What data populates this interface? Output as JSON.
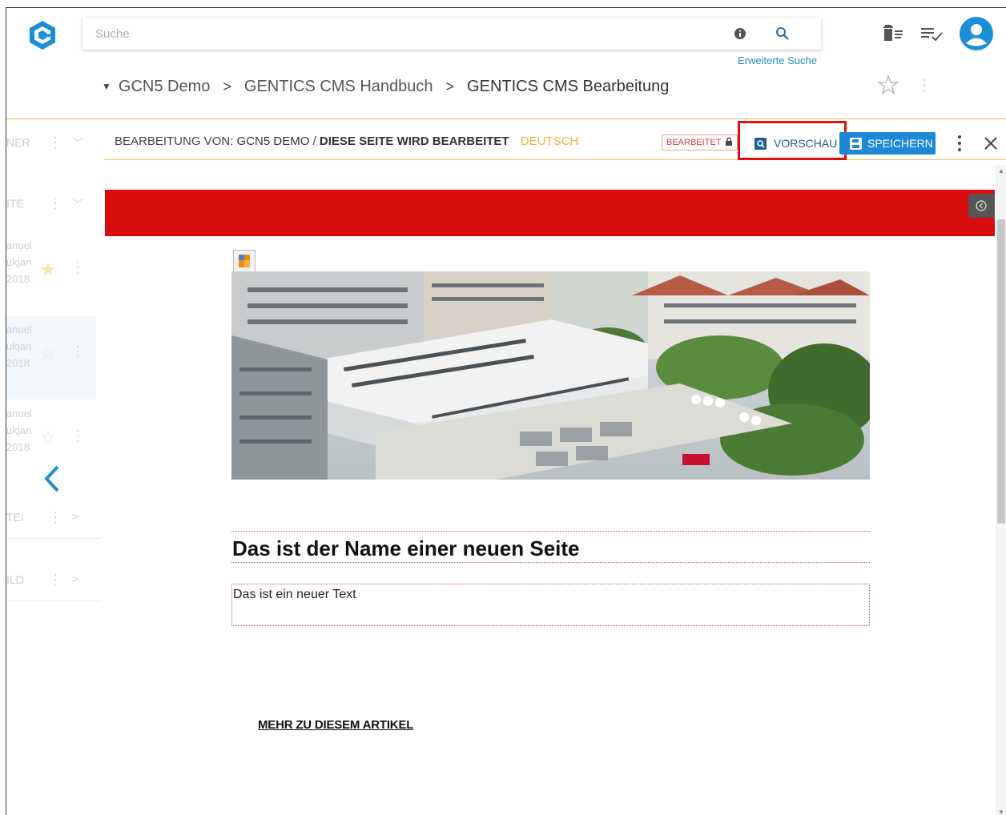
{
  "header": {
    "search_placeholder": "Suche",
    "advanced_search": "Erweiterte Suche"
  },
  "breadcrumb": {
    "items": [
      "GCN5 Demo",
      "GENTICS CMS Handbuch",
      "GENTICS CMS Bearbeitung"
    ]
  },
  "sidebar": {
    "sections": [
      {
        "label": "NER"
      },
      {
        "label": "ITE"
      },
      {
        "label": "TEI"
      },
      {
        "label": "ILD"
      }
    ],
    "items": [
      {
        "line1": "anuel",
        "line2": "ukjan",
        "line3": "2018",
        "favorite": true
      },
      {
        "line1": "anuel",
        "line2": "ukjan",
        "line3": "2018",
        "favorite": false
      },
      {
        "line1": "anuel",
        "line2": "ukjan",
        "line3": "2018",
        "favorite": false
      }
    ]
  },
  "editbar": {
    "label_prefix": "BEARBEITUNG VON:",
    "node": "GCN5 DEMO",
    "separator": "/",
    "page_title": "DIESE SEITE WIRD BEARBEITET",
    "language": "DEUTSCH",
    "status": "BEARBEITET",
    "preview_label": "VORSCHAU",
    "save_label": "SPEICHERN"
  },
  "page": {
    "heading": "Das ist der Name einer neuen Seite",
    "text": "Das ist ein neuer Text",
    "more_link": "MEHR ZU DIESEM ARTIKEL"
  },
  "colors": {
    "accent_blue": "#1e88d6",
    "brand_red": "#d90d0d",
    "language_orange": "#f0b040",
    "highlight_red": "#e01010"
  },
  "icons": [
    "gentics-logo-icon",
    "info-icon",
    "search-icon",
    "trash-icon",
    "tasks-icon",
    "user-avatar-icon",
    "star-icon",
    "more-vert-icon",
    "lock-icon",
    "preview-icon",
    "save-icon",
    "close-icon",
    "chevron-left-icon"
  ]
}
